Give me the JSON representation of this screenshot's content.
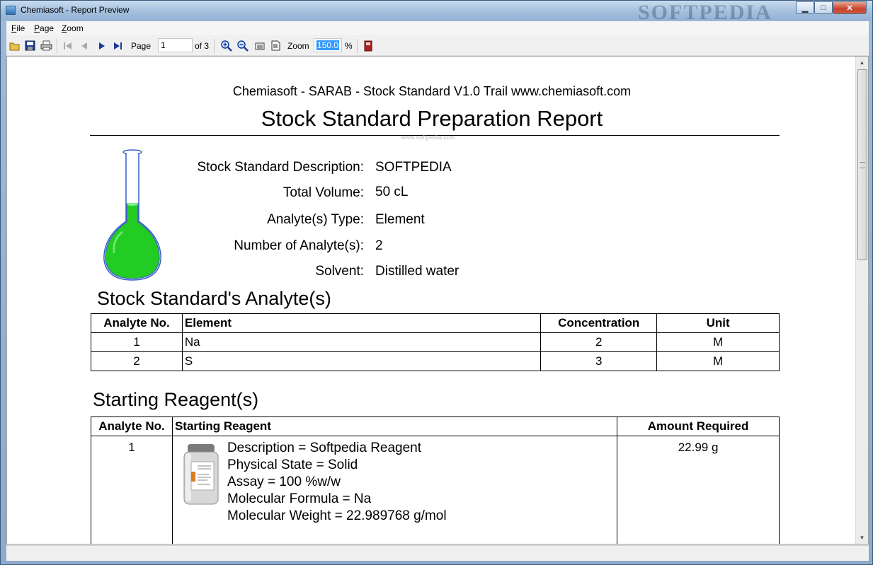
{
  "window": {
    "title": "Chemiasoft - Report Preview",
    "watermark": "SOFTPEDIA",
    "controls": {
      "minimize": "▁",
      "maximize": "□",
      "close": "✕"
    }
  },
  "menu": [
    "File",
    "Page",
    "Zoom"
  ],
  "toolbar": {
    "page_label": "Page",
    "page_value": "1",
    "page_of": "of 3",
    "zoom_label": "Zoom",
    "zoom_value": "150.0",
    "zoom_unit": "%",
    "icons": [
      "open-icon",
      "save-icon",
      "print-icon",
      "first-page-icon",
      "prev-page-icon",
      "next-page-icon",
      "last-page-icon",
      "zoom-in-icon",
      "zoom-out-icon",
      "fit-width-icon",
      "fit-page-icon",
      "exit-icon"
    ]
  },
  "report": {
    "subtitle": "Chemiasoft - SARAB - Stock Standard V1.0 Trail www.chemiasoft.com",
    "title": "Stock Standard Preparation Report",
    "watermark_small": "www.softpedia.com",
    "fields": [
      {
        "label": "Stock Standard Description:",
        "value": "SOFTPEDIA"
      },
      {
        "label": "Total Volume:",
        "value": "50 cL"
      },
      {
        "label": "Analyte(s) Type:",
        "value": "Element"
      },
      {
        "label": "Number of Analyte(s):",
        "value": "2"
      },
      {
        "label": "Solvent:",
        "value": "Distilled water"
      }
    ],
    "analytes_section": "Stock Standard's Analyte(s)",
    "analytes_headers": [
      "Analyte No.",
      "Element",
      "Concentration",
      "Unit"
    ],
    "analytes_rows": [
      [
        "1",
        "Na",
        "2",
        "M"
      ],
      [
        "2",
        "S",
        "3",
        "M"
      ]
    ],
    "reagents_section": "Starting Reagent(s)",
    "reagents_headers": [
      "Analyte No.",
      "Starting Reagent",
      "Amount Required"
    ],
    "reagents_rows": [
      {
        "no": "1",
        "lines": [
          "Description = Softpedia Reagent",
          "Physical State = Solid",
          "Assay = 100 %w/w",
          "Molecular Formula = Na",
          "Molecular Weight = 22.989768 g/mol"
        ],
        "amount": "22.99 g"
      }
    ]
  },
  "colors": {
    "flask_liquid": "#22cc22",
    "flask_outline": "#3a5fc8",
    "selection": "#3399ff"
  }
}
